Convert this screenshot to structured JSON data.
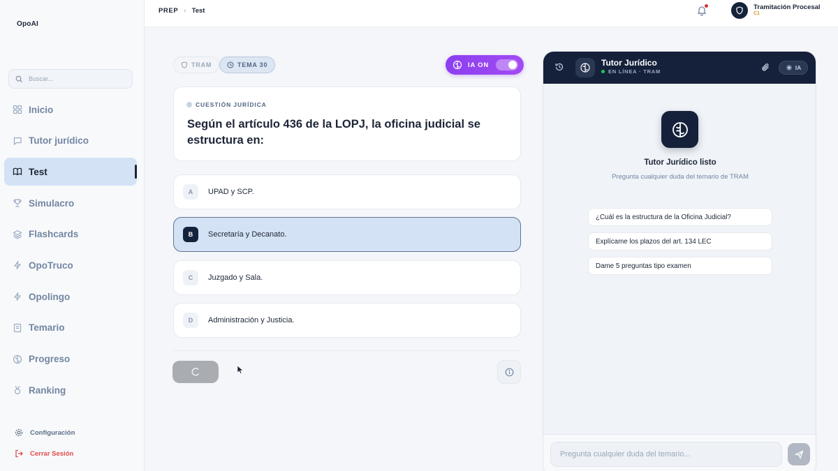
{
  "sidebar": {
    "logo": "OpoAI",
    "search_placeholder": "Buscar...",
    "items": [
      {
        "label": "Inicio",
        "icon": "grid-icon"
      },
      {
        "label": "Tutor jurídico",
        "icon": "chat-icon"
      },
      {
        "label": "Test",
        "icon": "book-open-icon",
        "active": true
      },
      {
        "label": "Simulacro",
        "icon": "trophy-icon"
      },
      {
        "label": "Flashcards",
        "icon": "layers-icon"
      },
      {
        "label": "OpoTruco",
        "icon": "bolt-icon"
      },
      {
        "label": "Opolingo",
        "icon": "bolt-icon"
      },
      {
        "label": "Temario",
        "icon": "book-icon"
      },
      {
        "label": "Progreso",
        "icon": "brain-icon"
      },
      {
        "label": "Ranking",
        "icon": "medal-icon"
      }
    ],
    "settings_label": "Configuración",
    "logout_label": "Cerrar Sesión"
  },
  "topbar": {
    "breadcrumb": [
      "PREP",
      "Test"
    ],
    "user_name": "Tramitación Procesal",
    "user_level": "C1",
    "notification_dot_color": "#d6343a"
  },
  "quiz": {
    "pill_tram": "TRAM",
    "pill_tema": "TEMA 30",
    "ia_toggle_label": "IA ON",
    "ia_on": true,
    "question_label": "CUESTIÓN JURÍDICA",
    "question_text": "Según el artículo 436 de la LOPJ, la oficina judicial se estructura en:",
    "options": [
      {
        "letter": "A",
        "text": "UPAD y SCP."
      },
      {
        "letter": "B",
        "text": "Secretaría y Decanato.",
        "selected": true
      },
      {
        "letter": "C",
        "text": "Juzgado y Sala."
      },
      {
        "letter": "D",
        "text": "Administración y Justicia."
      }
    ]
  },
  "tutor": {
    "title": "Tutor Jurídico",
    "status": "EN LÍNEA · TRAM",
    "ia_badge": "IA",
    "ready_title": "Tutor Jurídico listo",
    "ready_subtitle": "Pregunta cualquier duda del temario de TRAM",
    "suggestions": [
      "¿Cuál es la estructura de la Oficina Judicial?",
      "Explícame los plazos del art. 134 LEC",
      "Dame 5 preguntas tipo examen"
    ],
    "input_placeholder": "Pregunta cualquier duda del temario..."
  },
  "colors": {
    "accent_dark": "#15213a",
    "ia_purple": "#9a45f1",
    "selected_bg": "#d3e2f4",
    "logout_red": "#e24a4a"
  }
}
